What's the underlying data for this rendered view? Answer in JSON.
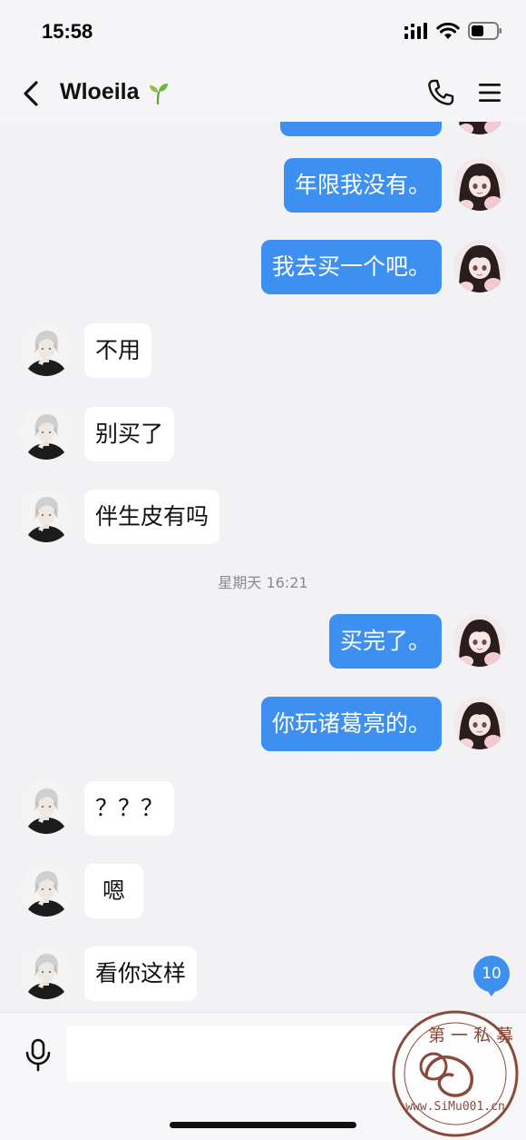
{
  "status_bar": {
    "time": "15:58"
  },
  "header": {
    "contact_name": "Wloeila"
  },
  "messages": [
    {
      "side": "out",
      "text": "年限我没有。"
    },
    {
      "side": "out",
      "text": "我去买一个吧。"
    },
    {
      "side": "in",
      "text": "不用"
    },
    {
      "side": "in",
      "text": "别买了"
    },
    {
      "side": "in",
      "text": "伴生皮有吗"
    },
    {
      "timestamp": "星期天 16:21"
    },
    {
      "side": "out",
      "text": "买完了。"
    },
    {
      "side": "out",
      "text": "你玩诸葛亮的。"
    },
    {
      "side": "in",
      "text": "？？？"
    },
    {
      "side": "in",
      "text": "嗯"
    },
    {
      "side": "in",
      "text": "看你这样"
    }
  ],
  "unread_count": "10",
  "input": {
    "value": "",
    "placeholder": ""
  },
  "watermark": {
    "text_top": "第一私募",
    "text_bottom": "www.SiMu001.cn"
  },
  "colors": {
    "outgoing_bubble": "#3d8ff0",
    "incoming_bubble": "#ffffff",
    "background": "#f2f2f4"
  }
}
